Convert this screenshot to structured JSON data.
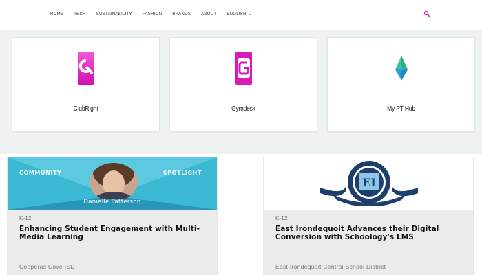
{
  "nav": {
    "links": [
      "HOME",
      "TECH",
      "SUSTAINABILITY",
      "FASHION",
      "BRANDS",
      "ABOUT"
    ],
    "language": "ENGLISH"
  },
  "apps": [
    {
      "name": "ClubRight",
      "logo": "clubright-logo"
    },
    {
      "name": "Gymdesk",
      "logo": "gymdesk-logo"
    },
    {
      "name": "My PT Hub",
      "logo": "mypthub-logo"
    }
  ],
  "articles": [
    {
      "banner": {
        "left_label": "COMMUNITY",
        "right_label": "SPOTLIGHT",
        "person": "Danielle Patterson"
      },
      "tag": "K-12",
      "title": "Enhancing Student Engagement with Multi-Media Learning",
      "org": "Copperas Cove ISD"
    },
    {
      "banner": {
        "seal_text": "EAST IRONDEQUOIT",
        "seal_letters": "EI"
      },
      "tag": "K-12",
      "title": "East Irondequoit Advances their Digital Conversion with Schoology's LMS",
      "org": "East Irondequoit Central School District"
    }
  ],
  "colors": {
    "accent": "#d11fb5",
    "band_bg": "#eef2f1",
    "spotlight_teal": "#3db3cf"
  }
}
